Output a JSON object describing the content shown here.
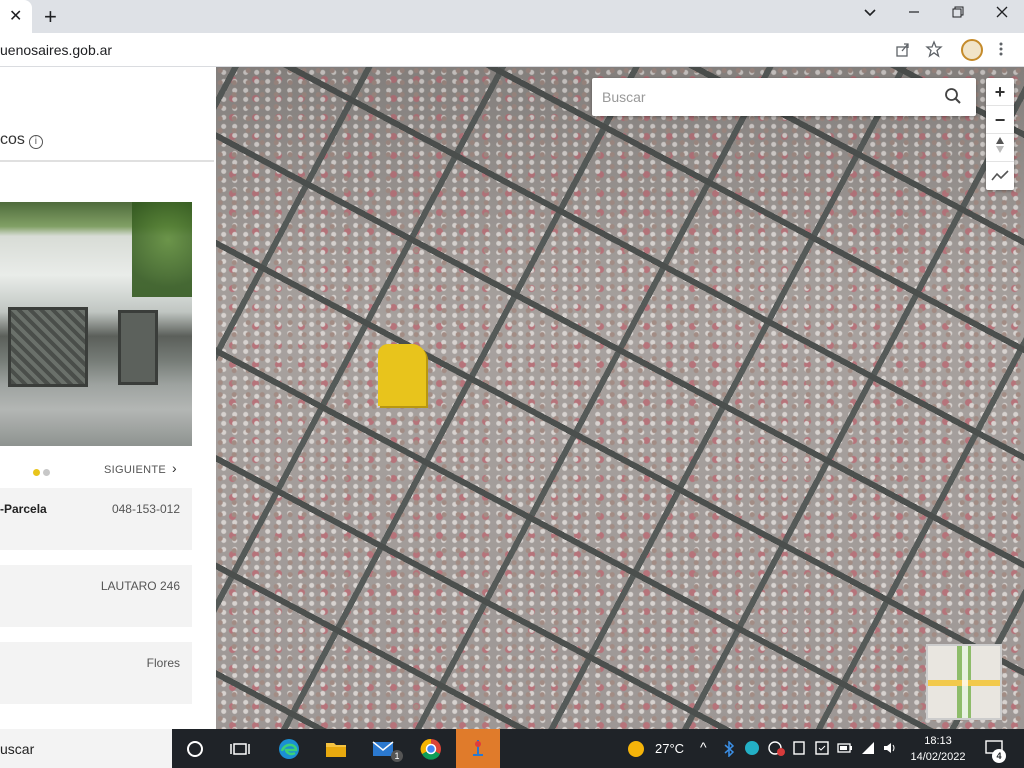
{
  "browser": {
    "url_text": "uenosaires.gob.ar",
    "newtab_label": "+",
    "close_tab_label": "✕"
  },
  "panel": {
    "section_title": "cos",
    "info_label": "i",
    "next_label": "SIGUIENTE",
    "carousel": {
      "total": 2,
      "active": 1,
      "active_color": "#e8c41c",
      "inactive_color": "#c7c7c7"
    },
    "fields": [
      {
        "label": "-Parcela",
        "value": "048-153-012"
      },
      {
        "label": "",
        "value": "LAUTARO 246"
      },
      {
        "label": "",
        "value": "Flores"
      }
    ]
  },
  "map": {
    "search_placeholder": "Buscar",
    "zoom_in": "+",
    "zoom_out": "−",
    "highlight_color": "#e8c41c"
  },
  "taskbar": {
    "search_text": "uscar",
    "weather": "27°C",
    "time": "18:13",
    "date": "14/02/2022",
    "notification_count": "4",
    "mail_badge": "1"
  }
}
